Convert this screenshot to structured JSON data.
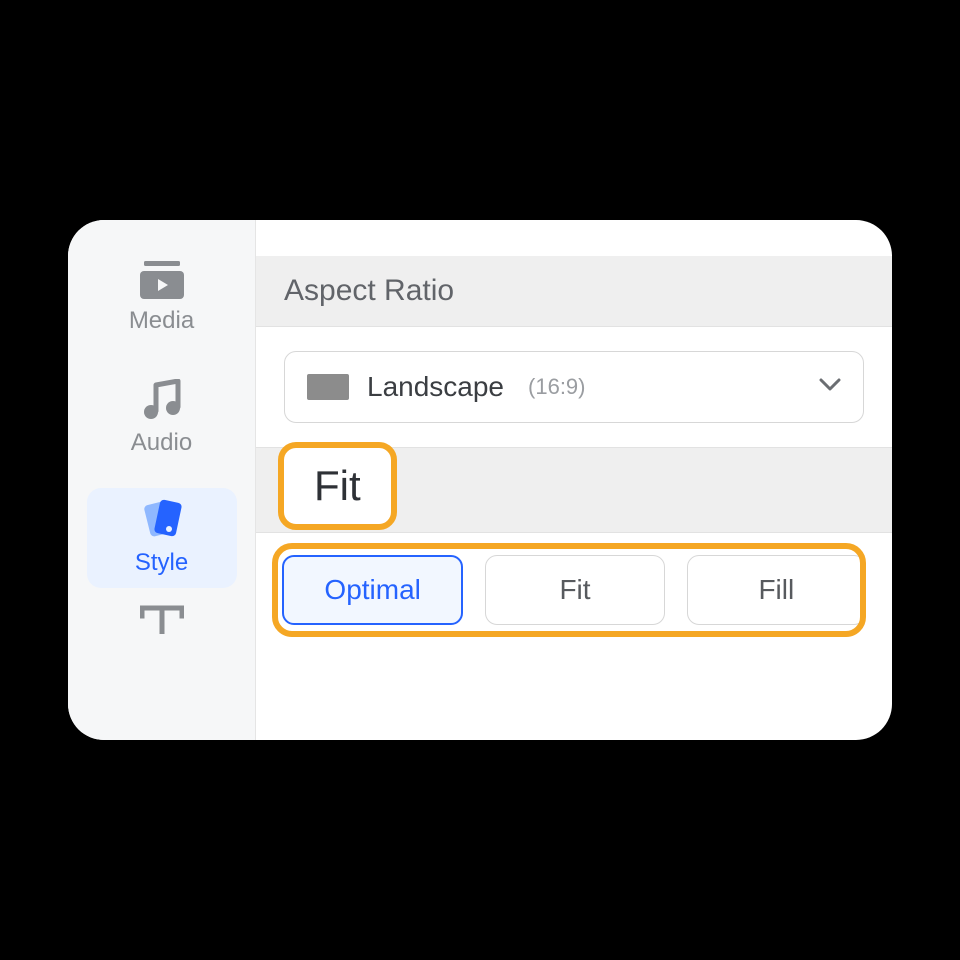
{
  "sidebar": {
    "items": [
      {
        "label": "Media",
        "active": false
      },
      {
        "label": "Audio",
        "active": false
      },
      {
        "label": "Style",
        "active": true
      }
    ]
  },
  "aspect": {
    "title": "Aspect Ratio",
    "selected_name": "Landscape",
    "selected_ratio": "(16:9)"
  },
  "fit": {
    "title": "Fit",
    "options": [
      "Optimal",
      "Fit",
      "Fill"
    ],
    "selected": "Optimal"
  },
  "highlight_color": "#f5a724",
  "accent_color": "#2563ff"
}
